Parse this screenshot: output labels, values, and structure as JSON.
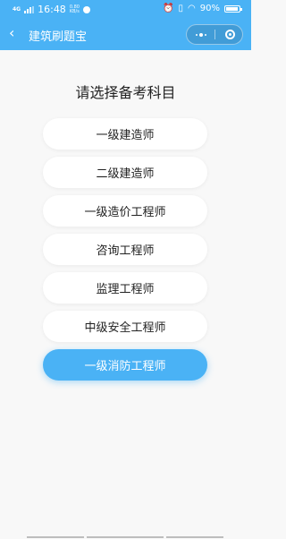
{
  "status_bar": {
    "network": "4G",
    "time": "16:48",
    "speed_value": "0.80",
    "speed_unit": "KB/s",
    "battery_text": "90%",
    "battery_level": 0.9,
    "icons": [
      "signal-icon",
      "alarm-icon",
      "vibrate-icon",
      "wifi-icon",
      "battery-icon"
    ]
  },
  "navbar": {
    "back_icon": "chevron-left-icon",
    "title": "建筑刷题宝",
    "more_icon": "more-dots-icon",
    "close_icon": "target-circle-icon"
  },
  "main": {
    "heading": "请选择备考科目",
    "options": [
      {
        "label": "一级建造师",
        "selected": false
      },
      {
        "label": "二级建造师",
        "selected": false
      },
      {
        "label": "一级造价工程师",
        "selected": false
      },
      {
        "label": "咨询工程师",
        "selected": false
      },
      {
        "label": "监理工程师",
        "selected": false
      },
      {
        "label": "中级安全工程师",
        "selected": false
      },
      {
        "label": "一级消防工程师",
        "selected": true
      }
    ]
  },
  "colors": {
    "accent": "#4ab2f5",
    "background": "#f8f8f8",
    "option_background": "#ffffff",
    "text": "#222222"
  }
}
